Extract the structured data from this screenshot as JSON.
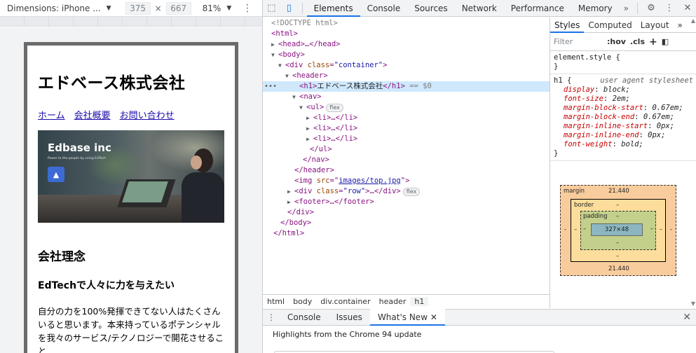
{
  "device_toolbar": {
    "dimensions_label": "Dimensions: iPhone ...",
    "width": "375",
    "times": "×",
    "height": "667",
    "zoom": "81%"
  },
  "phone_page": {
    "h1": "エドベース株式会社",
    "nav": [
      "ホーム",
      "会社概要",
      "お問い合わせ"
    ],
    "hero": {
      "brand": "Edbase inc",
      "tagline": "Power to the people by using EdTech",
      "logo_glyph": "▲"
    },
    "h2": "会社理念",
    "h3": "EdTechで人々に力を与えたい",
    "paragraph": "自分の力を100%発揮できてない人はたくさんいると思います。本来持っているポテンシャルを我々のサービス/テクノロジーで開花させること"
  },
  "devtools": {
    "tabs": [
      "Elements",
      "Console",
      "Sources",
      "Network",
      "Performance",
      "Memory"
    ],
    "more_tabs": "»",
    "active_tab": "Elements",
    "dom": {
      "doctype": "<!DOCTYPE html>",
      "html_open": "<html>",
      "head": "<head>…</head>",
      "body_open": "<body>",
      "div_container_tag": "div",
      "div_container_attr": "class",
      "div_container_val": "\"container\"",
      "header_open": "<header>",
      "h1_open": "<h1>",
      "h1_text": "エドベース株式会社",
      "h1_close": "</h1>",
      "h1_eq": " == $0",
      "nav_open": "<nav>",
      "ul_open": "<ul>",
      "flex_badge": "flex",
      "li_item": "<li>…</li>",
      "ul_close": "</ul>",
      "nav_close": "</nav>",
      "header_close": "</header>",
      "img_tag": "img",
      "img_attr": "src",
      "img_src": "images/top.jpg",
      "div_row_attr": "class",
      "div_row_val": "\"row\"",
      "footer": "<footer>…</footer>",
      "div_close": "</div>",
      "body_close": "</body>",
      "html_close": "</html>"
    },
    "breadcrumbs": [
      "html",
      "body",
      "div.container",
      "header",
      "h1"
    ],
    "styles": {
      "tabs": [
        "Styles",
        "Computed",
        "Layout"
      ],
      "more": "»",
      "filter_placeholder": "Filter",
      "hov": ":hov",
      "cls": ".cls",
      "element_style": "element.style {",
      "close_brace": "}",
      "h1_selector": "h1 {",
      "ua_label": "user agent stylesheet",
      "props": [
        {
          "name": "display",
          "value": "block;"
        },
        {
          "name": "font-size",
          "value": "2em;"
        },
        {
          "name": "margin-block-start",
          "value": "0.67em;"
        },
        {
          "name": "margin-block-end",
          "value": "0.67em;"
        },
        {
          "name": "margin-inline-start",
          "value": "0px;"
        },
        {
          "name": "margin-inline-end",
          "value": "0px;"
        },
        {
          "name": "font-weight",
          "value": "bold;"
        }
      ]
    },
    "box_model": {
      "margin_label": "margin",
      "margin_top": "21.440",
      "margin_bottom": "21.440",
      "margin_side": "-",
      "border_label": "border",
      "border_value": "–",
      "padding_label": "padding",
      "padding_value": "–",
      "content": "327×48"
    },
    "drawer": {
      "tabs": [
        "Console",
        "Issues",
        "What's New"
      ],
      "active": "What's New",
      "headline": "Highlights from the Chrome 94 update"
    }
  }
}
